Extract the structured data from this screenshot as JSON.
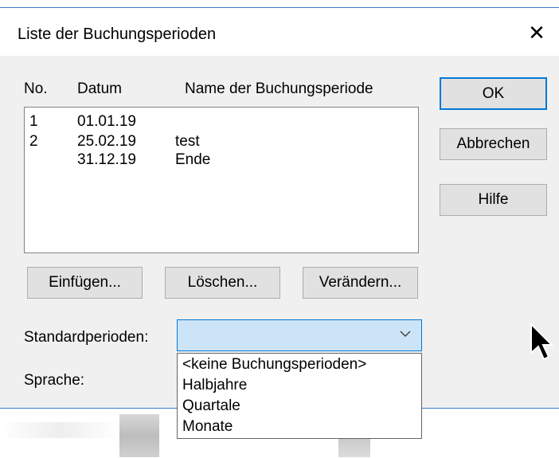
{
  "window": {
    "title": "Liste der Buchungsperioden",
    "close_glyph": "✕"
  },
  "list": {
    "columns": [
      "No.",
      "Datum",
      "Name der Buchungsperiode"
    ],
    "rows": [
      {
        "no": "1",
        "datum": "01.01.19",
        "name": ""
      },
      {
        "no": "2",
        "datum": "25.02.19",
        "name": "test"
      },
      {
        "no": "",
        "datum": "31.12.19",
        "name": "Ende"
      }
    ]
  },
  "buttons": {
    "ok": "OK",
    "abbrechen": "Abbrechen",
    "hilfe": "Hilfe",
    "einfuegen": "Einfügen...",
    "loeschen": "Löschen...",
    "veraendern": "Verändern..."
  },
  "fields": {
    "standardperioden_label": "Standardperioden:",
    "standardperioden_value": "",
    "sprache_label": "Sprache:"
  },
  "dropdown": {
    "options": [
      "<keine Buchungsperioden>",
      "Halbjahre",
      "Quartale",
      "Monate"
    ]
  },
  "colors": {
    "accent": "#0078d7",
    "combo_bg": "#cce4f7",
    "dialog_bg": "#f0f0f0",
    "button_bg": "#e1e1e1"
  }
}
